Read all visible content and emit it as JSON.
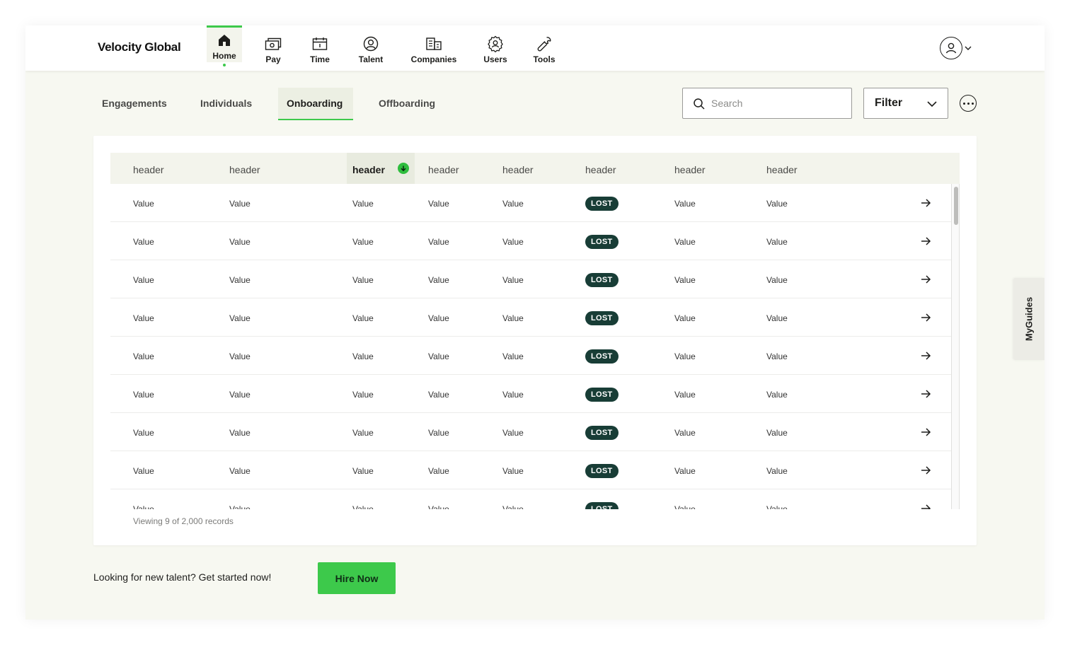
{
  "brand": {
    "name": "Velocity Global",
    "accent": "#3dc94b",
    "badge_color": "#183d36"
  },
  "nav": {
    "items": [
      {
        "label": "Home",
        "icon": "home-icon",
        "active": true
      },
      {
        "label": "Pay",
        "icon": "money-icon"
      },
      {
        "label": "Time",
        "icon": "calendar-icon"
      },
      {
        "label": "Talent",
        "icon": "talent-icon"
      },
      {
        "label": "Companies",
        "icon": "building-icon"
      },
      {
        "label": "Users",
        "icon": "users-icon"
      },
      {
        "label": "Tools",
        "icon": "wrench-icon"
      }
    ],
    "profile_icon": "user-avatar-icon"
  },
  "tabs": [
    {
      "label": "Engagements"
    },
    {
      "label": "Individuals"
    },
    {
      "label": "Onboarding",
      "active": true
    },
    {
      "label": "Offboarding"
    }
  ],
  "search": {
    "placeholder": "Search"
  },
  "filter": {
    "label": "Filter"
  },
  "table": {
    "headers": [
      "header",
      "header",
      "header",
      "header",
      "header",
      "header",
      "header",
      "header"
    ],
    "sorted_column": 2,
    "rows": [
      [
        "Value",
        "Value",
        "Value",
        "Value",
        "Value",
        "LOST",
        "Value",
        "Value"
      ],
      [
        "Value",
        "Value",
        "Value",
        "Value",
        "Value",
        "LOST",
        "Value",
        "Value"
      ],
      [
        "Value",
        "Value",
        "Value",
        "Value",
        "Value",
        "LOST",
        "Value",
        "Value"
      ],
      [
        "Value",
        "Value",
        "Value",
        "Value",
        "Value",
        "LOST",
        "Value",
        "Value"
      ],
      [
        "Value",
        "Value",
        "Value",
        "Value",
        "Value",
        "LOST",
        "Value",
        "Value"
      ],
      [
        "Value",
        "Value",
        "Value",
        "Value",
        "Value",
        "LOST",
        "Value",
        "Value"
      ],
      [
        "Value",
        "Value",
        "Value",
        "Value",
        "Value",
        "LOST",
        "Value",
        "Value"
      ],
      [
        "Value",
        "Value",
        "Value",
        "Value",
        "Value",
        "LOST",
        "Value",
        "Value"
      ],
      [
        "Value",
        "Value",
        "Value",
        "Value",
        "Value",
        "LOST",
        "Value",
        "Value"
      ]
    ],
    "footer": "Viewing 9 of 2,000 records"
  },
  "cta": {
    "text": "Looking for new talent? Get started now!",
    "button": "Hire Now"
  },
  "myguides": {
    "label": "MyGuides"
  }
}
